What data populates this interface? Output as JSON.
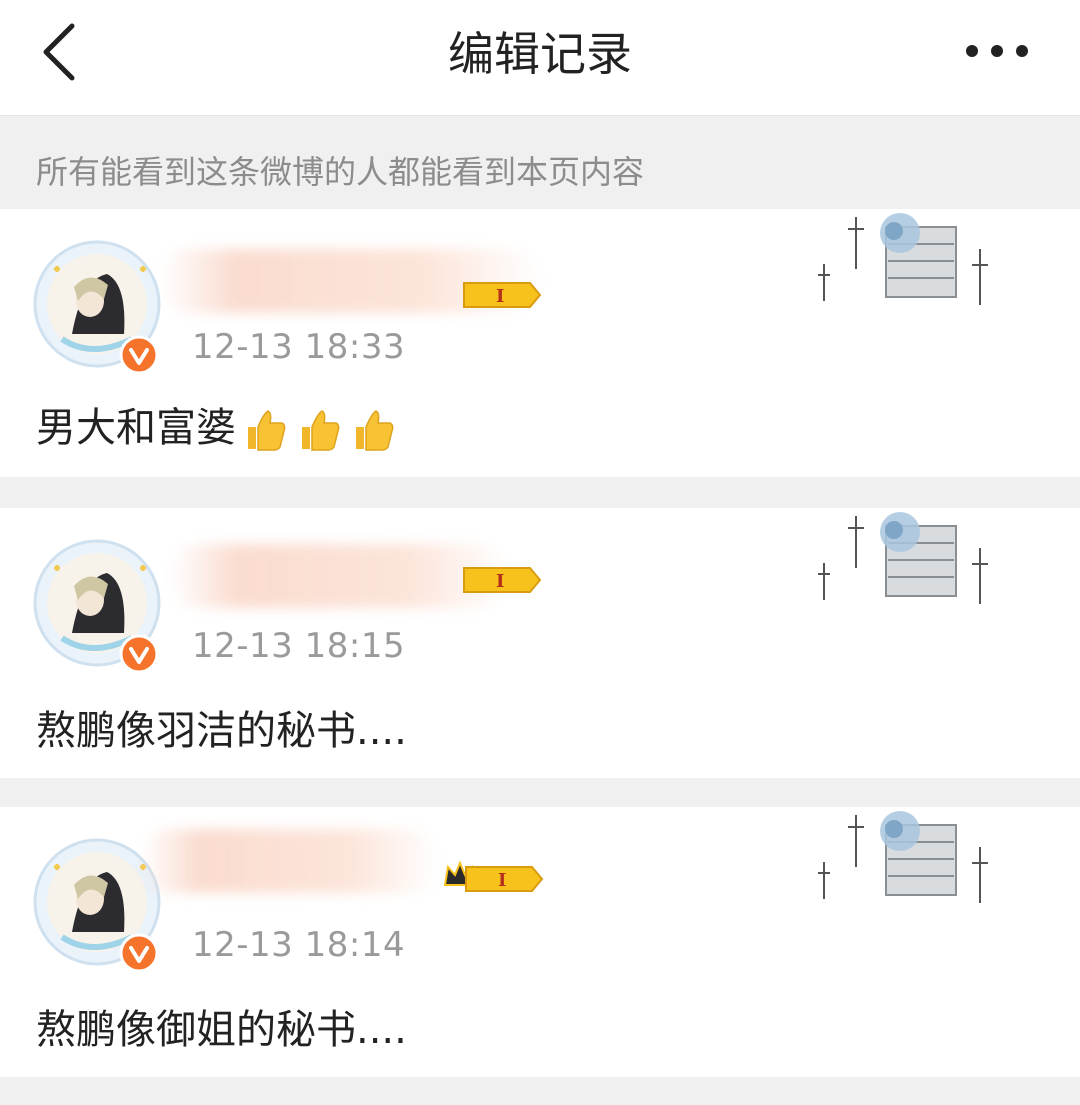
{
  "header": {
    "title": "编辑记录",
    "back_icon": "chevron-left-icon",
    "more_icon": "more-dots-icon"
  },
  "notice": {
    "text": "所有能看到这条微博的人都能看到本页内容"
  },
  "records": [
    {
      "time": "12-13 18:33",
      "text": "男大和富婆",
      "emoji": [
        "thumbs-up",
        "thumbs-up",
        "thumbs-up"
      ]
    },
    {
      "time": "12-13 18:15",
      "text": "熬鹏像羽洁的秘书....",
      "emoji": []
    },
    {
      "time": "12-13 18:14",
      "text": "熬鹏像御姐的秘书....",
      "emoji": []
    }
  ],
  "colors": {
    "background": "#f0f0f0",
    "card": "#ffffff",
    "verify_badge": "#f5732a",
    "level_badge": "#f6c21b",
    "timestamp": "#9a9a9a",
    "notice_text": "#8c8c8c"
  }
}
